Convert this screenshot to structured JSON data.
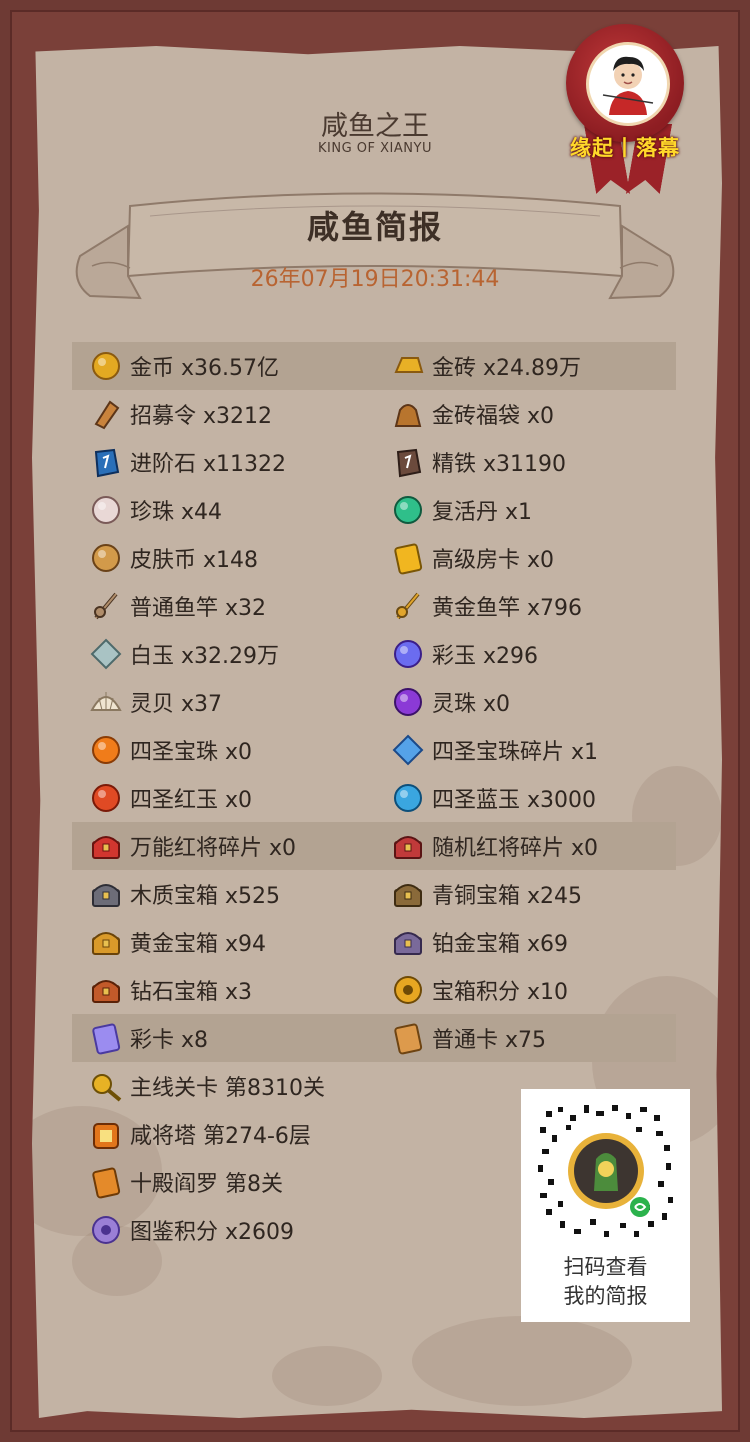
{
  "header": {
    "title": "咸鱼之王",
    "subtitle": "KING OF XIANYU",
    "banner_title": "咸鱼简报",
    "date": "26年07月19日20:31:44"
  },
  "seal": {
    "text": "缘起丨落幕"
  },
  "items_left": [
    {
      "label": "金币 x36.57亿",
      "icon": "gold-coin-icon"
    },
    {
      "label": "招募令 x3212",
      "icon": "recruit-token-icon"
    },
    {
      "label": "进阶石 x11322",
      "icon": "advance-stone-icon"
    },
    {
      "label": "珍珠 x44",
      "icon": "pearl-icon"
    },
    {
      "label": "皮肤币 x148",
      "icon": "skin-coin-icon"
    },
    {
      "label": "普通鱼竿 x32",
      "icon": "fishing-rod-icon"
    },
    {
      "label": "白玉 x32.29万",
      "icon": "white-jade-icon"
    },
    {
      "label": "灵贝 x37",
      "icon": "shell-icon"
    },
    {
      "label": "四圣宝珠 x0",
      "icon": "four-saints-orb-icon"
    },
    {
      "label": "四圣红玉 x0",
      "icon": "four-saints-red-jade-icon"
    },
    {
      "label": "万能红将碎片 x0",
      "icon": "red-general-shard-icon"
    },
    {
      "label": "木质宝箱 x525",
      "icon": "wooden-chest-icon"
    },
    {
      "label": "黄金宝箱 x94",
      "icon": "gold-chest-icon"
    },
    {
      "label": "钻石宝箱 x3",
      "icon": "diamond-chest-icon"
    },
    {
      "label": "彩卡 x8",
      "icon": "rainbow-card-icon"
    },
    {
      "label": "主线关卡 第8310关",
      "icon": "main-stage-icon"
    },
    {
      "label": "咸将塔 第274-6层",
      "icon": "tower-icon"
    },
    {
      "label": "十殿阎罗 第8关",
      "icon": "ten-halls-icon"
    },
    {
      "label": "图鉴积分 x2609",
      "icon": "codex-points-icon"
    }
  ],
  "items_right": [
    {
      "label": "金砖 x24.89万",
      "icon": "gold-brick-icon"
    },
    {
      "label": "金砖福袋 x0",
      "icon": "gold-brick-bag-icon"
    },
    {
      "label": "精铁 x31190",
      "icon": "refined-iron-icon"
    },
    {
      "label": "复活丹 x1",
      "icon": "revive-pill-icon"
    },
    {
      "label": "高级房卡 x0",
      "icon": "premium-room-card-icon"
    },
    {
      "label": "黄金鱼竿 x796",
      "icon": "gold-fishing-rod-icon"
    },
    {
      "label": "彩玉 x296",
      "icon": "rainbow-jade-icon"
    },
    {
      "label": "灵珠 x0",
      "icon": "spirit-orb-icon"
    },
    {
      "label": "四圣宝珠碎片 x1",
      "icon": "four-saints-orb-shard-icon"
    },
    {
      "label": "四圣蓝玉 x3000",
      "icon": "four-saints-blue-jade-icon"
    },
    {
      "label": "随机红将碎片 x0",
      "icon": "random-red-general-shard-icon"
    },
    {
      "label": "青铜宝箱 x245",
      "icon": "bronze-chest-icon"
    },
    {
      "label": "铂金宝箱 x69",
      "icon": "platinum-chest-icon"
    },
    {
      "label": "宝箱积分 x10",
      "icon": "chest-points-icon"
    },
    {
      "label": "普通卡 x75",
      "icon": "normal-card-icon"
    }
  ],
  "qr": {
    "line1": "扫码查看",
    "line2": "我的简报"
  },
  "colors": {
    "frame": "#6e3a34",
    "parchment": "#c3b3a4",
    "highlight_row": "#b3a392",
    "date": "#b86432",
    "seal_text": "#ffd82a"
  }
}
